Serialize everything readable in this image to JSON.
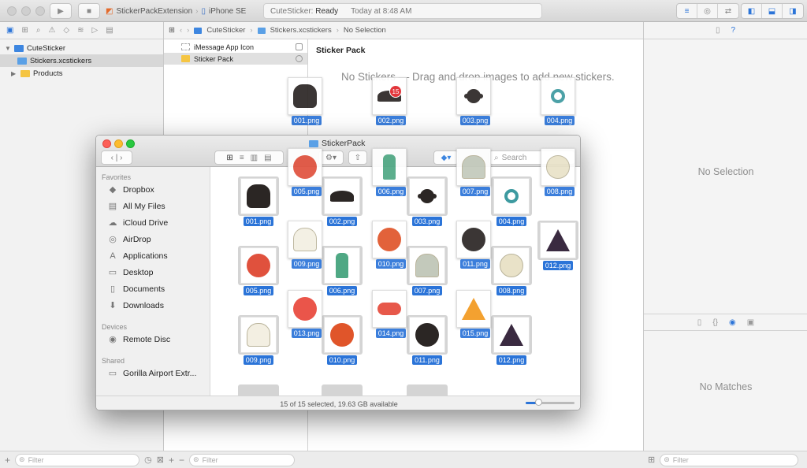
{
  "toolbar": {
    "scheme_target": "StickerPackExtension",
    "scheme_device": "iPhone SE",
    "status_project": "CuteSticker:",
    "status_state": "Ready",
    "status_time": "Today at 8:48 AM"
  },
  "navigator": {
    "project": "CuteSticker",
    "items": [
      {
        "label": "Stickers.xcstickers",
        "selected": true
      },
      {
        "label": "Products",
        "selected": false
      }
    ],
    "filter_placeholder": "Filter"
  },
  "jumpbar": {
    "project": "CuteSticker",
    "file": "Stickers.xcstickers",
    "selection": "No Selection"
  },
  "asset_list": {
    "items": [
      {
        "label": "iMessage App Icon"
      },
      {
        "label": "Sticker Pack"
      }
    ],
    "filter_placeholder": "Filter"
  },
  "canvas": {
    "title": "Sticker Pack",
    "empty_message": "No Stickers — Drag and drop images to add new stickers."
  },
  "inspector": {
    "top_message": "No Selection",
    "bottom_message": "No Matches",
    "filter_placeholder": "Filter"
  },
  "finder": {
    "title": "StickerPack",
    "search_placeholder": "Search",
    "sidebar": {
      "favorites_label": "Favorites",
      "favorites": [
        {
          "label": "Dropbox",
          "icon": "dropbox-icon"
        },
        {
          "label": "All My Files",
          "icon": "all-files-icon"
        },
        {
          "label": "iCloud Drive",
          "icon": "cloud-icon"
        },
        {
          "label": "AirDrop",
          "icon": "airdrop-icon"
        },
        {
          "label": "Applications",
          "icon": "applications-icon"
        },
        {
          "label": "Desktop",
          "icon": "desktop-icon"
        },
        {
          "label": "Documents",
          "icon": "documents-icon"
        },
        {
          "label": "Downloads",
          "icon": "downloads-icon"
        }
      ],
      "devices_label": "Devices",
      "devices": [
        {
          "label": "Remote Disc",
          "icon": "disc-icon"
        }
      ],
      "shared_label": "Shared",
      "shared": [
        {
          "label": "Gorilla Airport Extr...",
          "icon": "monitor-icon"
        }
      ]
    },
    "files": [
      {
        "name": "001.png",
        "art": "black-cat"
      },
      {
        "name": "002.png",
        "art": "bat"
      },
      {
        "name": "003.png",
        "art": "spider"
      },
      {
        "name": "004.png",
        "art": "eyeball"
      },
      {
        "name": "012.png",
        "art": "witch-hat"
      },
      {
        "name": "005.png",
        "art": "red-monster"
      },
      {
        "name": "006.png",
        "art": "zombie-hand"
      },
      {
        "name": "007.png",
        "art": "tombstone"
      },
      {
        "name": "008.png",
        "art": "skull"
      },
      {
        "name": "009.png",
        "art": "ghost"
      },
      {
        "name": "010.png",
        "art": "pumpkin"
      },
      {
        "name": "011.png",
        "art": "cauldron"
      },
      {
        "name": "012.png",
        "art": "witch-hat"
      }
    ],
    "dragged": [
      {
        "name": "001.png",
        "art": "black-cat"
      },
      {
        "name": "002.png",
        "art": "bat"
      },
      {
        "name": "003.png",
        "art": "spider"
      },
      {
        "name": "004.png",
        "art": "eyeball"
      },
      {
        "name": "005.png",
        "art": "red-monster"
      },
      {
        "name": "006.png",
        "art": "zombie-hand"
      },
      {
        "name": "007.png",
        "art": "tombstone"
      },
      {
        "name": "008.png",
        "art": "skull"
      },
      {
        "name": "009.png",
        "art": "ghost"
      },
      {
        "name": "010.png",
        "art": "pumpkin"
      },
      {
        "name": "011.png",
        "art": "cauldron"
      },
      {
        "name": "013.png",
        "art": "lollipop"
      },
      {
        "name": "014.png",
        "art": "candy"
      },
      {
        "name": "015.png",
        "art": "candy-corn"
      }
    ],
    "drag_count": "15",
    "status": "15 of 15 selected, 19.63 GB available"
  },
  "art_colors": {
    "black-cat": "#2b2624",
    "bat": "#2b2624",
    "spider": "#2b2624",
    "eyeball": "#3d9aa0",
    "witch-hat": "#3a2a40",
    "red-monster": "#e0513d",
    "zombie-hand": "#4fa884",
    "tombstone": "#c3c9bb",
    "skull": "#e9e2c8",
    "ghost": "#f3efe2",
    "pumpkin": "#e0552a",
    "cauldron": "#2b2624",
    "lollipop": "#e9473b",
    "candy": "#e64a3b",
    "candy-corn": "#f39a1f"
  }
}
